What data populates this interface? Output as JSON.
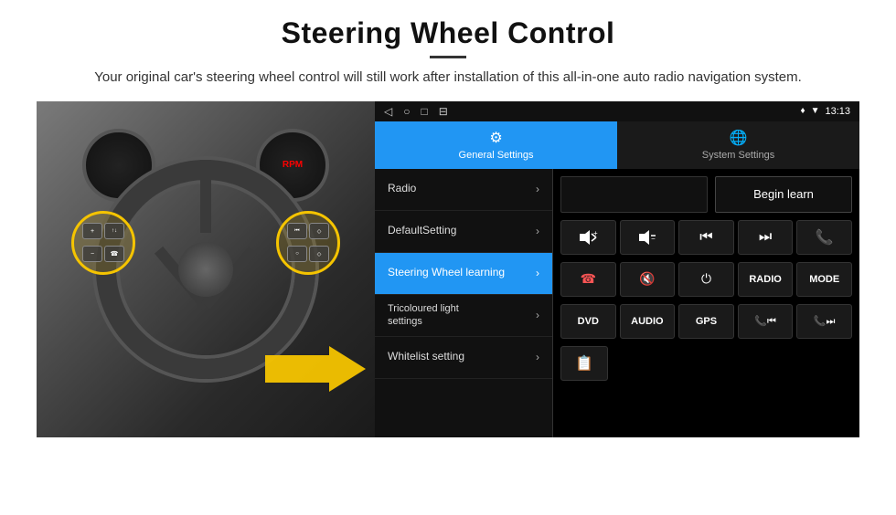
{
  "header": {
    "title": "Steering Wheel Control",
    "subtitle": "Your original car's steering wheel control will still work after installation of this all-in-one auto radio navigation system."
  },
  "android": {
    "status_bar": {
      "time": "13:13",
      "nav_icons": [
        "◁",
        "○",
        "□",
        "⊟"
      ]
    },
    "tabs": [
      {
        "label": "General Settings",
        "icon": "⚙",
        "active": true
      },
      {
        "label": "System Settings",
        "icon": "🌐",
        "active": false
      }
    ],
    "menu_items": [
      {
        "label": "Radio",
        "active": false
      },
      {
        "label": "DefaultSetting",
        "active": false
      },
      {
        "label": "Steering Wheel learning",
        "active": true
      },
      {
        "label": "Tricoloured light settings",
        "active": false
      },
      {
        "label": "Whitelist setting",
        "active": false
      }
    ],
    "right_panel": {
      "begin_learn_label": "Begin learn",
      "control_buttons_row1": [
        "🔊+",
        "🔊-",
        "⏮",
        "⏭",
        "📞"
      ],
      "control_buttons_row2": [
        "📞",
        "🔇",
        "⏻",
        "RADIO",
        "MODE"
      ],
      "control_buttons_row3": [
        "DVD",
        "AUDIO",
        "GPS",
        "📞⏮",
        "📞⏭"
      ],
      "last_btn": "📋"
    }
  }
}
